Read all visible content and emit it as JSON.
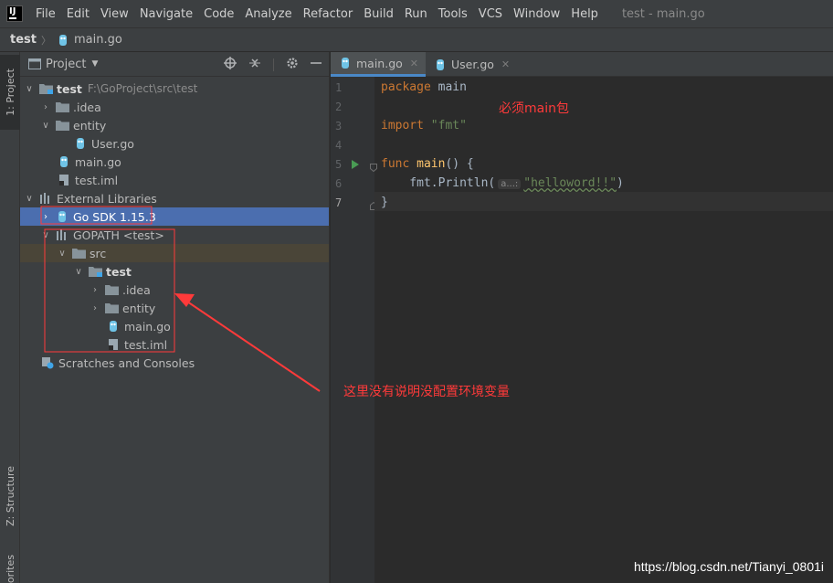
{
  "menubar": {
    "items": [
      {
        "label": "File"
      },
      {
        "label": "Edit"
      },
      {
        "label": "View"
      },
      {
        "label": "Navigate"
      },
      {
        "label": "Code"
      },
      {
        "label": "Analyze"
      },
      {
        "label": "Refactor"
      },
      {
        "label": "Build"
      },
      {
        "label": "Run"
      },
      {
        "label": "Tools"
      },
      {
        "label": "VCS"
      },
      {
        "label": "Window"
      },
      {
        "label": "Help"
      }
    ],
    "window_title": "test - main.go"
  },
  "breadcrumb": {
    "root": "test",
    "file": "main.go"
  },
  "left_strip": {
    "project_tab": "1: Project",
    "structure_tab": "Z: Structure",
    "favorites_tab": "orites"
  },
  "project_panel": {
    "title": "Project",
    "tree": [
      {
        "label": "test",
        "suffix": "F:\\GoProject\\src\\test"
      },
      {
        "label": ".idea"
      },
      {
        "label": "entity"
      },
      {
        "label": "User.go"
      },
      {
        "label": "main.go"
      },
      {
        "label": "test.iml"
      },
      {
        "label": "External Libraries"
      },
      {
        "label": "Go SDK 1.15.3"
      },
      {
        "label": "GOPATH <test>"
      },
      {
        "label": "src"
      },
      {
        "label": "test"
      },
      {
        "label": ".idea"
      },
      {
        "label": "entity"
      },
      {
        "label": "main.go"
      },
      {
        "label": "test.iml"
      },
      {
        "label": "Scratches and Consoles"
      }
    ]
  },
  "editor": {
    "tabs": [
      {
        "label": "main.go"
      },
      {
        "label": "User.go"
      }
    ],
    "line_numbers": [
      "1",
      "2",
      "3",
      "4",
      "5",
      "6",
      "7"
    ],
    "code": {
      "l1_kw": "package",
      "l1_rest": " main",
      "l3_kw": "import",
      "l3_str": "\"fmt\"",
      "l5_kw": "func",
      "l5_fn": "main",
      "l5_rest": "() {",
      "l6_a": "    fmt.Println(",
      "l6_hint": "a...:",
      "l6_str": "\"helloword!!\"",
      "l6_b": ")",
      "l7": "}"
    }
  },
  "annotations": {
    "main_note": "必须main包",
    "env_note": "这里没有说明没配置环境变量",
    "color": "#ff3a3a"
  },
  "watermark": "https://blog.csdn.net/Tianyi_0801i"
}
